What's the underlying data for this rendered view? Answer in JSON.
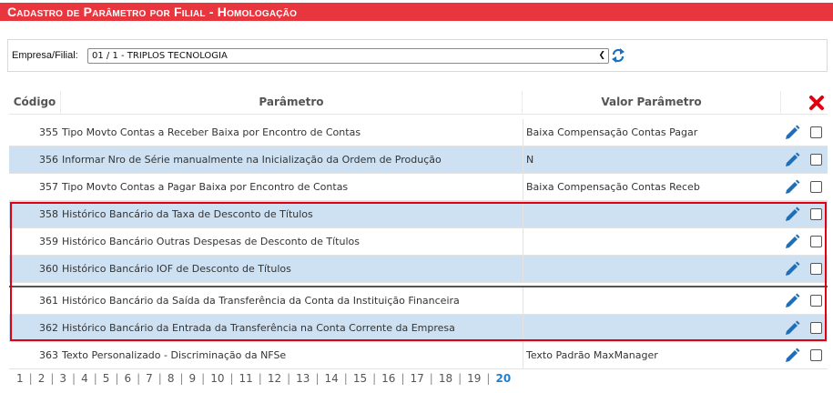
{
  "title": "Cadastro de Parâmetro por Filial  - Homologação",
  "filter": {
    "label": "Empresa/Filial:",
    "selected": "01 / 1 - TRIPLOS TECNOLOGIA"
  },
  "table": {
    "headers": {
      "code": "Código",
      "param": "Parâmetro",
      "value": "Valor Parâmetro"
    },
    "rows": [
      {
        "code": "355",
        "param": "Tipo Movto Contas a Receber Baixa por Encontro de Contas",
        "value": "Baixa Compensação Contas Pagar"
      },
      {
        "code": "356",
        "param": "Informar Nro de Série manualmente na Inicialização da Ordem de Produção",
        "value": "N"
      },
      {
        "code": "357",
        "param": "Tipo Movto Contas a Pagar Baixa por Encontro de Contas",
        "value": "Baixa Compensação Contas Receb"
      },
      {
        "code": "358",
        "param": "Histórico Bancário da Taxa de Desconto de Títulos",
        "value": ""
      },
      {
        "code": "359",
        "param": "Histórico Bancário Outras Despesas de Desconto de Títulos",
        "value": ""
      },
      {
        "code": "360",
        "param": "Histórico Bancário IOF de Desconto de Títulos",
        "value": ""
      },
      {
        "code": "361",
        "param": "Histórico Bancário da Saída da Transferência da Conta da Instituição Financeira",
        "value": ""
      },
      {
        "code": "362",
        "param": "Histórico Bancário da Entrada da Transferência na Conta Corrente da Empresa",
        "value": ""
      },
      {
        "code": "363",
        "param": "Texto Personalizado - Discriminação da NFSe",
        "value": "Texto Padrão MaxManager"
      }
    ]
  },
  "pagination": {
    "pages": [
      "1",
      "2",
      "3",
      "4",
      "5",
      "6",
      "7",
      "8",
      "9",
      "10",
      "11",
      "12",
      "13",
      "14",
      "15",
      "16",
      "17",
      "18",
      "19",
      "20"
    ],
    "current": "20"
  },
  "colors": {
    "title_bg": "#e8363f",
    "row_alt": "#cde1f2",
    "highlight_border": "#e0000f",
    "edit_icon": "#1f6fb8",
    "delete_icon": "#e0000f"
  },
  "icons": {
    "refresh": "refresh-icon",
    "delete_all": "delete-x-icon",
    "edit": "pencil-edit-icon"
  }
}
